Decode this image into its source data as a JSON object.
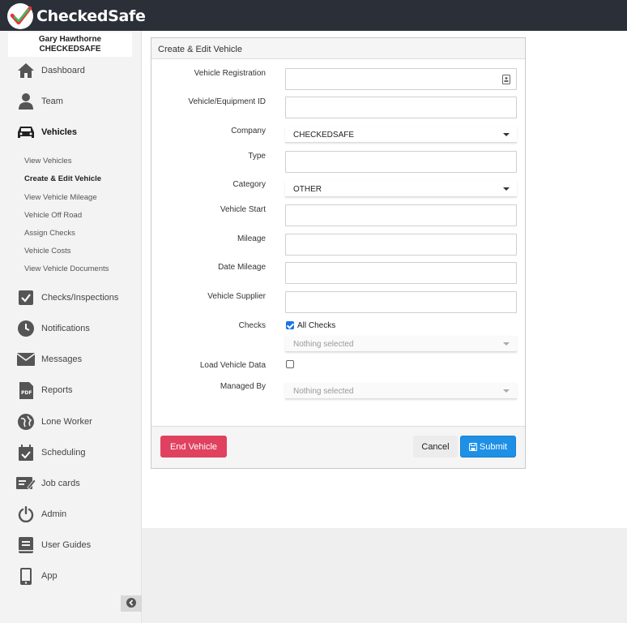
{
  "app": {
    "name": "CheckedSafe"
  },
  "user": {
    "name": "Gary Hawthorne",
    "company": "CHECKEDSAFE"
  },
  "nav": {
    "dashboard": "Dashboard",
    "team": "Team",
    "vehicles": "Vehicles",
    "vehicle_sub": [
      "View Vehicles",
      "Create & Edit Vehicle",
      "View Vehicle Mileage",
      "Vehicle Off Road",
      "Assign Checks",
      "Vehicle Costs",
      "View Vehicle Documents"
    ],
    "checks": "Checks/Inspections",
    "notifications": "Notifications",
    "messages": "Messages",
    "reports": "Reports",
    "lone_worker": "Lone Worker",
    "scheduling": "Scheduling",
    "job_cards": "Job cards",
    "admin": "Admin",
    "user_guides": "User Guides",
    "app": "App"
  },
  "form": {
    "title": "Create & Edit Vehicle",
    "labels": {
      "registration": "Vehicle Registration",
      "equipment_id": "Vehicle/Equipment ID",
      "company": "Company",
      "type": "Type",
      "category": "Category",
      "start": "Vehicle Start",
      "mileage": "Mileage",
      "date_mileage": "Date Mileage",
      "supplier": "Vehicle Supplier",
      "checks": "Checks",
      "load_data": "Load Vehicle Data",
      "managed_by": "Managed By"
    },
    "values": {
      "company": "CHECKEDSAFE",
      "category": "OTHER",
      "all_checks": "All Checks",
      "all_checks_checked": true,
      "load_data_checked": false,
      "checks_select": "Nothing selected",
      "managed_by": "Nothing selected"
    },
    "buttons": {
      "end_vehicle": "End Vehicle",
      "cancel": "Cancel",
      "submit": "Submit"
    }
  },
  "colors": {
    "topbar": "#2b2f38",
    "danger": "#e0415f",
    "primary": "#1e90e6",
    "logo_red": "#e8323c",
    "logo_green": "#3cbc5a"
  }
}
